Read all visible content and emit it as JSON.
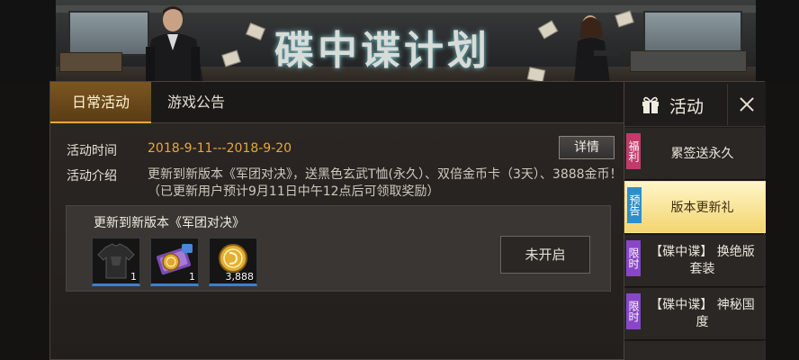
{
  "banner": {
    "title": "碟中谍计划"
  },
  "tabs": [
    {
      "label": "日常活动",
      "active": true
    },
    {
      "label": "游戏公告",
      "active": false
    }
  ],
  "event": {
    "time_label": "活动时间",
    "time_value": "2018-9-11---2018-9-20",
    "intro_label": "活动介绍",
    "intro_value": "更新到新版本《军团对决》，送黑色玄武T恤(永久）、双倍金币卡（3天）、3888金币！（已更新用户预计9月11日中午12点后可领取奖励）",
    "detail_button": "详情"
  },
  "reward": {
    "title": "更新到新版本《军团对决》",
    "items": [
      {
        "icon": "tshirt-icon",
        "qty": "1"
      },
      {
        "icon": "double-coin-card-icon",
        "qty": "1"
      },
      {
        "icon": "gold-coin-icon",
        "qty": "3,888"
      }
    ],
    "status_button": "未开启"
  },
  "side": {
    "title": "活动",
    "entries": [
      {
        "tag": "福利",
        "tag_color": "#c23a6a",
        "label": "累签送永久",
        "selected": false
      },
      {
        "tag": "预告",
        "tag_color": "#2e8fc8",
        "label": "版本更新礼",
        "selected": true
      },
      {
        "tag": "限时",
        "tag_color": "#8a46c8",
        "label": "【碟中谍】 换绝版套装",
        "selected": false
      },
      {
        "tag": "限时",
        "tag_color": "#8a46c8",
        "label": "【碟中谍】 神秘国度",
        "selected": false
      }
    ]
  },
  "colors": {
    "accent": "#e8a83a",
    "item_border": "#3f7fc8"
  }
}
